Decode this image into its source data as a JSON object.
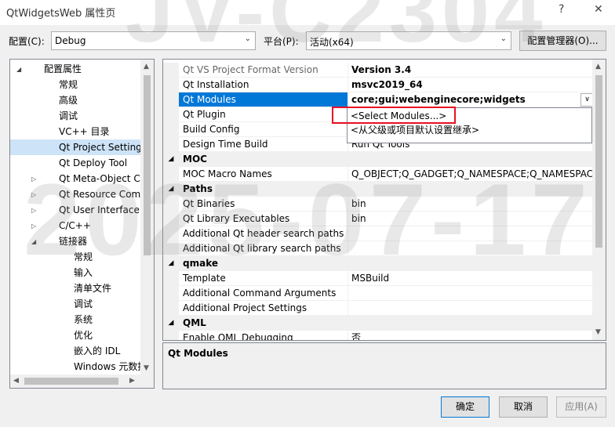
{
  "window": {
    "title": "QtWidgetsWeb 属性页",
    "help": "?",
    "close": "✕"
  },
  "config": {
    "config_label": "配置(C):",
    "config_value": "Debug",
    "platform_label": "平台(P):",
    "platform_value": "活动(x64)",
    "manager_button": "配置管理器(O)..."
  },
  "tree": {
    "items": [
      {
        "label": "配置属性",
        "level": 0,
        "expander": "open"
      },
      {
        "label": "常规",
        "level": 1
      },
      {
        "label": "高级",
        "level": 1
      },
      {
        "label": "调试",
        "level": 1
      },
      {
        "label": "VC++ 目录",
        "level": 1
      },
      {
        "label": "Qt Project Settings",
        "level": 1,
        "selected": true
      },
      {
        "label": "Qt Deploy Tool",
        "level": 1
      },
      {
        "label": "Qt Meta-Object Com",
        "level": 1,
        "expander": "closed"
      },
      {
        "label": "Qt Resource Compile",
        "level": 1,
        "expander": "closed"
      },
      {
        "label": "Qt User Interface Co",
        "level": 1,
        "expander": "closed"
      },
      {
        "label": "C/C++",
        "level": 1,
        "expander": "closed"
      },
      {
        "label": "链接器",
        "level": 1,
        "expander": "open"
      },
      {
        "label": "常规",
        "level": 2
      },
      {
        "label": "输入",
        "level": 2
      },
      {
        "label": "清单文件",
        "level": 2
      },
      {
        "label": "调试",
        "level": 2
      },
      {
        "label": "系统",
        "level": 2
      },
      {
        "label": "优化",
        "level": 2
      },
      {
        "label": "嵌入的 IDL",
        "level": 2
      },
      {
        "label": "Windows 元数据",
        "level": 2
      }
    ]
  },
  "grid": {
    "rows": [
      {
        "type": "prop",
        "name": "Qt VS Project Format Version",
        "value": "Version 3.4",
        "style": "gray-bold"
      },
      {
        "type": "prop",
        "name": "Qt Installation",
        "value": "msvc2019_64",
        "style": "bold"
      },
      {
        "type": "prop",
        "name": "Qt Modules",
        "value": "core;gui;webenginecore;widgets",
        "style": "bold-hl"
      },
      {
        "type": "prop",
        "name": "Qt Plugin",
        "value": ""
      },
      {
        "type": "prop",
        "name": "Build Config",
        "value": ""
      },
      {
        "type": "prop",
        "name": "Design Time Build",
        "value": "Run Qt Tools"
      },
      {
        "type": "cat",
        "name": "MOC"
      },
      {
        "type": "prop",
        "name": "MOC Macro Names",
        "value": "Q_OBJECT;Q_GADGET;Q_NAMESPACE;Q_NAMESPACE"
      },
      {
        "type": "cat",
        "name": "Paths"
      },
      {
        "type": "prop",
        "name": "Qt Binaries",
        "value": "bin"
      },
      {
        "type": "prop",
        "name": "Qt Library Executables",
        "value": "bin"
      },
      {
        "type": "prop",
        "name": "Additional Qt header search paths",
        "value": ""
      },
      {
        "type": "prop",
        "name": "Additional Qt library search paths",
        "value": ""
      },
      {
        "type": "cat",
        "name": "qmake"
      },
      {
        "type": "prop",
        "name": "Template",
        "value": "MSBuild"
      },
      {
        "type": "prop",
        "name": "Additional Command Arguments",
        "value": ""
      },
      {
        "type": "prop",
        "name": "Additional Project Settings",
        "value": ""
      },
      {
        "type": "cat",
        "name": "QML"
      },
      {
        "type": "prop",
        "name": "Enable QML Debugging",
        "value": "否"
      }
    ],
    "dropdown_items": [
      "<Select Modules...>",
      "<从父级或项目默认设置继承>"
    ]
  },
  "description": {
    "title": "Qt Modules"
  },
  "buttons": {
    "ok": "确定",
    "cancel": "取消",
    "apply": "应用(A)"
  },
  "watermark": {
    "top": "JV-C2304",
    "mid": "2025-07-17"
  }
}
